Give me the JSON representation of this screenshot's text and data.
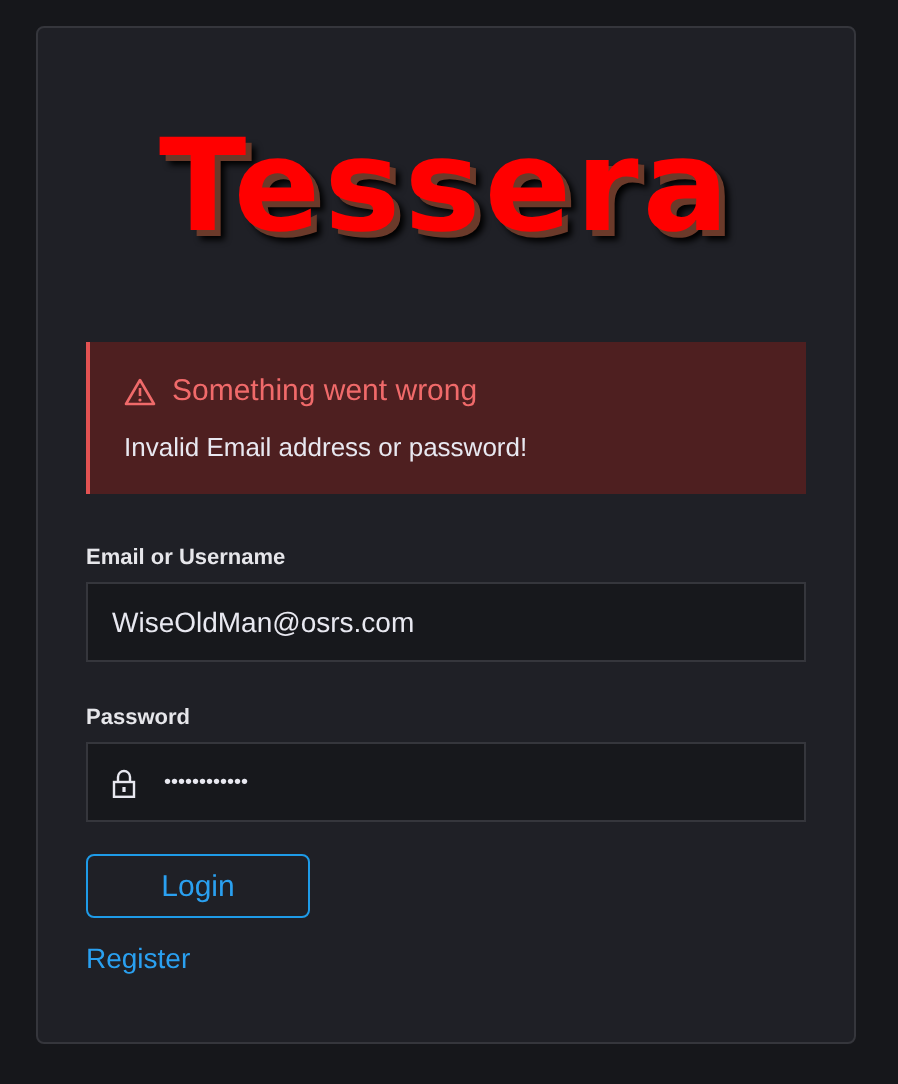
{
  "logo": {
    "text": "Tessera"
  },
  "alert": {
    "title": "Something went wrong",
    "message": "Invalid Email address or password!"
  },
  "fields": [
    {
      "kind": "text",
      "label": "Email or Username",
      "value": "WiseOldMan@osrs.com"
    },
    {
      "kind": "password",
      "label": "Password",
      "value": "••••••••••••"
    }
  ],
  "login_button": "Login",
  "register_link": "Register"
}
